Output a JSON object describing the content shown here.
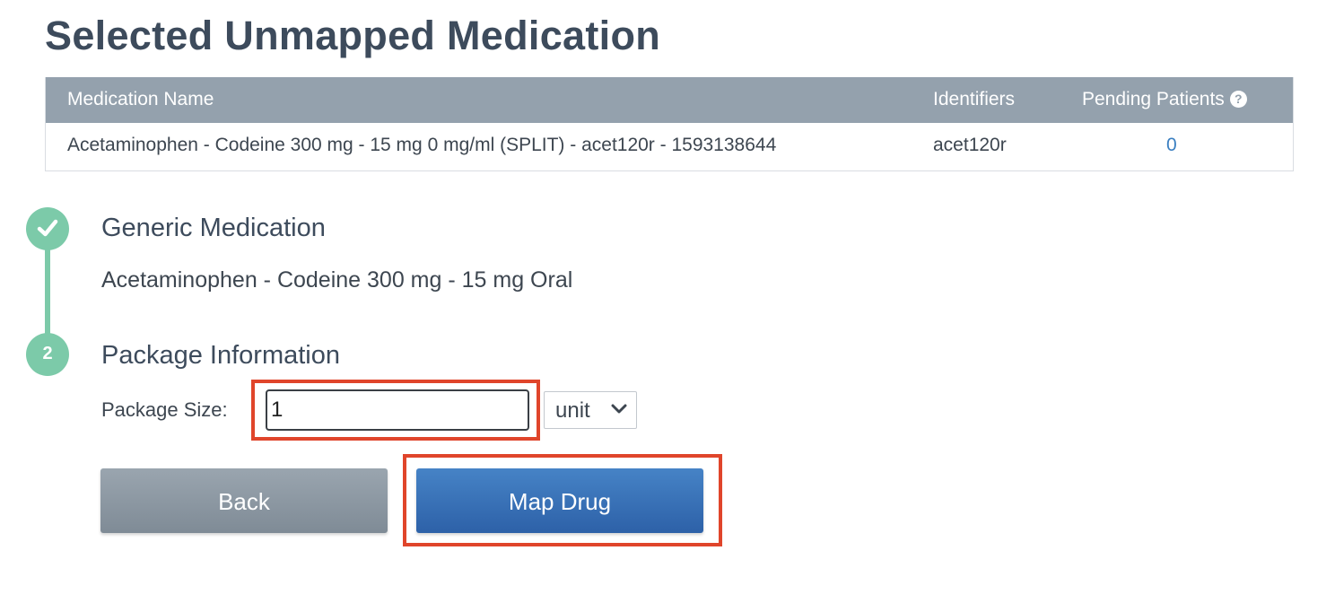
{
  "page_title": "Selected Unmapped Medication",
  "table": {
    "headers": {
      "name": "Medication Name",
      "identifiers": "Identifiers",
      "pending": "Pending Patients"
    },
    "rows": [
      {
        "name": "Acetaminophen - Codeine 300 mg - 15 mg 0 mg/ml (SPLIT) - acet120r - 1593138644",
        "identifiers": "acet120r",
        "pending": "0"
      }
    ]
  },
  "steps": {
    "step1": {
      "title": "Generic Medication",
      "value": "Acetaminophen - Codeine 300 mg - 15 mg Oral",
      "status": "complete"
    },
    "step2": {
      "number": "2",
      "title": "Package Information"
    }
  },
  "package": {
    "size_label": "Package Size:",
    "size_value": "1",
    "unit_selected": "unit"
  },
  "buttons": {
    "back": "Back",
    "map": "Map Drug"
  },
  "colors": {
    "step_accent": "#7ccaa9",
    "primary_button": "#2d61a8",
    "secondary_button": "#8a96a1",
    "highlight": "#e0452b",
    "link": "#3a7fc1"
  },
  "icons": {
    "help": "question-circle-icon",
    "complete": "checkmark-icon",
    "select": "chevron-down-icon"
  }
}
